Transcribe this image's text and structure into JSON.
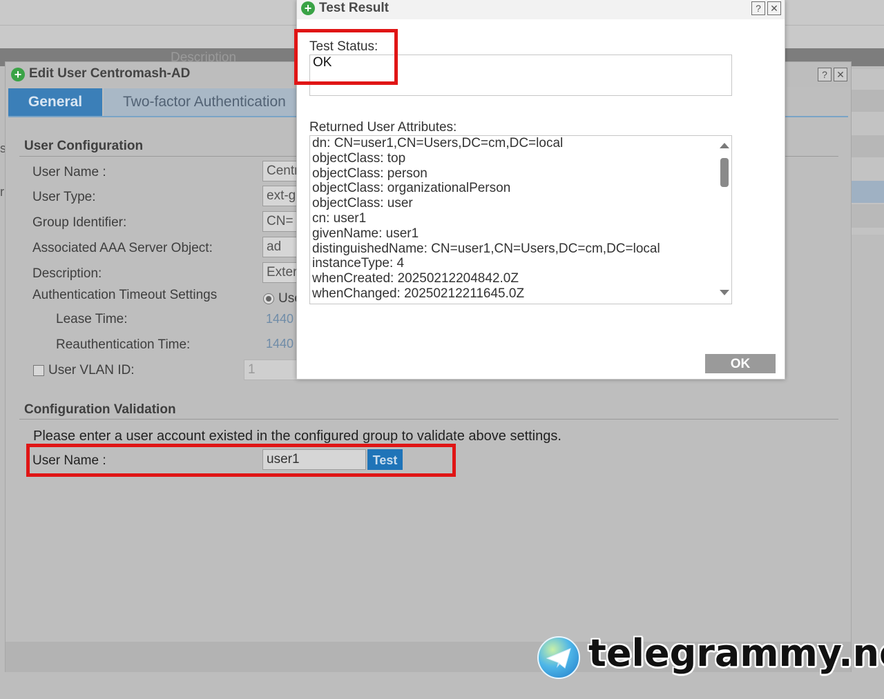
{
  "background": {
    "header_col": "Description"
  },
  "edit_dialog": {
    "title": "Edit User Centromash-AD",
    "help_glyph": "?",
    "close_glyph": "✕",
    "tabs": [
      {
        "label": "General"
      },
      {
        "label": "Two-factor Authentication"
      }
    ],
    "user_config": {
      "title": "User Configuration",
      "user_name_label": "User Name :",
      "user_name_value": "Centromash-AD",
      "user_type_label": "User Type:",
      "user_type_value": "ext-group-user",
      "group_id_label": "Group Identifier:",
      "group_id_value": "CN=",
      "aaa_label": "Associated AAA Server Object:",
      "aaa_value": "ad",
      "desc_label": "Description:",
      "desc_value": "External",
      "auth_timeout_label": "Authentication Timeout Settings",
      "auth_timeout_option": "Use",
      "lease_label": "Lease Time:",
      "lease_value": "1440",
      "reauth_label": "Reauthentication Time:",
      "reauth_value": "1440",
      "vlan_label": "User VLAN ID:",
      "vlan_value": "1"
    },
    "validation": {
      "title": "Configuration Validation",
      "instruction": "Please enter a user account existed in the configured group to validate above settings.",
      "user_name_label": "User Name :",
      "user_name_value": "user1",
      "test_label": "Test"
    }
  },
  "test_result": {
    "title": "Test Result",
    "help_glyph": "?",
    "close_glyph": "✕",
    "status_label": "Test Status:",
    "status_value": "OK",
    "attributes_label": "Returned User Attributes:",
    "attributes": [
      "dn: CN=user1,CN=Users,DC=cm,DC=local",
      "objectClass: top",
      "objectClass: person",
      "objectClass: organizationalPerson",
      "objectClass: user",
      "cn: user1",
      "givenName: user1",
      "distinguishedName: CN=user1,CN=Users,DC=cm,DC=local",
      "instanceType: 4",
      "whenCreated: 20250212204842.0Z",
      "whenChanged: 20250212211645.0Z"
    ],
    "ok_label": "OK"
  },
  "watermark": {
    "text": "telegrammy.net"
  },
  "colors": {
    "accent_blue": "#3b7fb8",
    "highlight_red": "#e01515",
    "plus_green": "#3aa346"
  }
}
